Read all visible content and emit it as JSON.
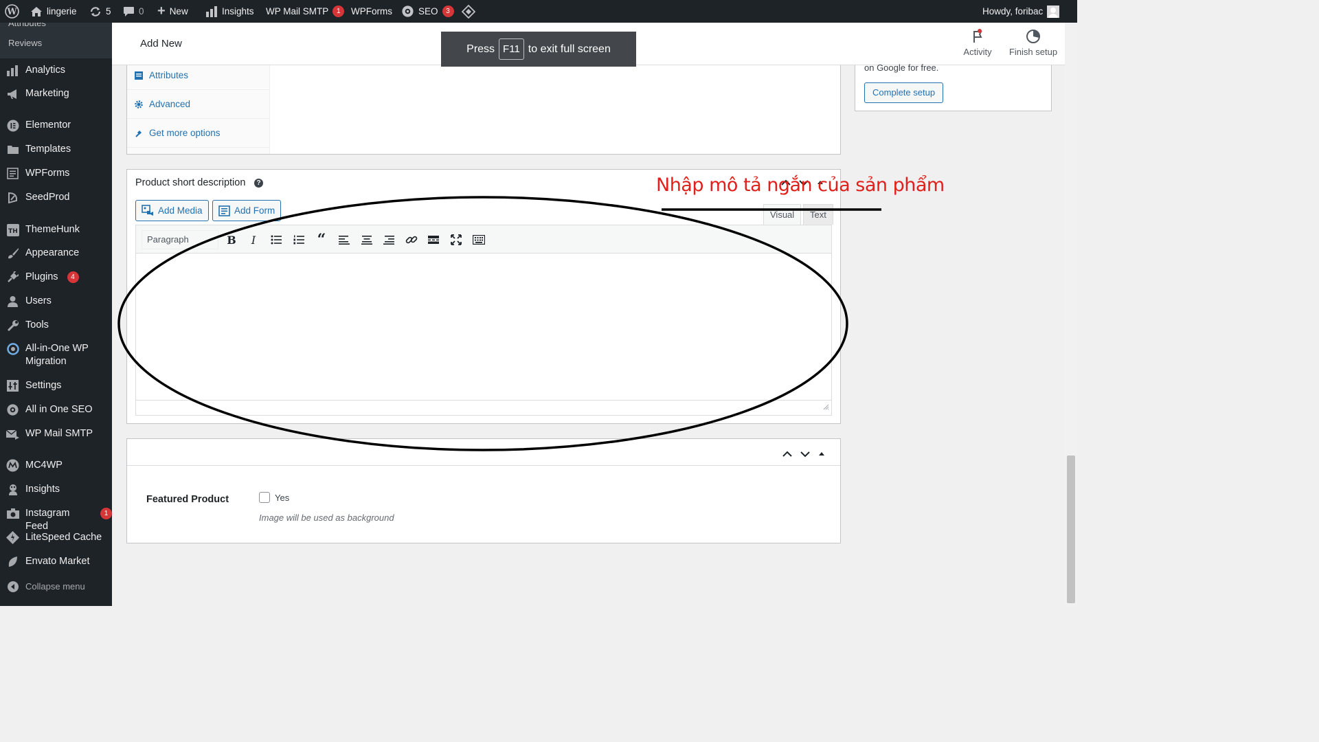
{
  "admin_bar": {
    "site_name": "lingerie",
    "updates_count": "5",
    "comments_count": "0",
    "new_label": "New",
    "insights_label": "Insights",
    "wpmail_label": "WP Mail SMTP",
    "wpmail_badge": "1",
    "wpforms_label": "WPForms",
    "seo_label": "SEO",
    "seo_badge": "3",
    "howdy": "Howdy, foribac"
  },
  "sidebar": {
    "sub_items": [
      "Attributes",
      "Reviews"
    ],
    "items": [
      {
        "label": "Analytics",
        "icon": "bar-chart-icon"
      },
      {
        "label": "Marketing",
        "icon": "megaphone-icon"
      },
      {
        "label": "Elementor",
        "icon": "elementor-icon"
      },
      {
        "label": "Templates",
        "icon": "folder-icon"
      },
      {
        "label": "WPForms",
        "icon": "form-icon"
      },
      {
        "label": "SeedProd",
        "icon": "seed-icon"
      },
      {
        "label": "ThemeHunk",
        "icon": "themehunk-icon"
      },
      {
        "label": "Appearance",
        "icon": "brush-icon"
      },
      {
        "label": "Plugins",
        "icon": "plug-icon",
        "badge": "4"
      },
      {
        "label": "Users",
        "icon": "user-icon"
      },
      {
        "label": "Tools",
        "icon": "wrench-icon"
      },
      {
        "label": "All-in-One WP Migration",
        "icon": "migration-icon"
      },
      {
        "label": "Settings",
        "icon": "settings-icon"
      },
      {
        "label": "All in One SEO",
        "icon": "seo-icon"
      },
      {
        "label": "WP Mail SMTP",
        "icon": "mail-icon"
      },
      {
        "label": "MC4WP",
        "icon": "mc4wp-icon"
      },
      {
        "label": "Insights",
        "icon": "insights-icon"
      },
      {
        "label": "Instagram Feed",
        "icon": "camera-icon",
        "badge": "1"
      },
      {
        "label": "LiteSpeed Cache",
        "icon": "litespeed-icon"
      },
      {
        "label": "Envato Market",
        "icon": "leaf-icon"
      },
      {
        "label": "Collapse menu",
        "icon": "collapse-icon"
      }
    ]
  },
  "header": {
    "title": "Add New",
    "activity_label": "Activity",
    "finish_label": "Finish setup"
  },
  "toast": {
    "press": "Press",
    "key": "F11",
    "rest": "to exit full screen"
  },
  "product_data": {
    "tabs": [
      "Attributes",
      "Advanced",
      "Get more options"
    ]
  },
  "google_box": {
    "text": "on Google for free.",
    "button": "Complete setup"
  },
  "short_description": {
    "title": "Product short description",
    "help": "?",
    "add_media": "Add Media",
    "add_form": "Add Form",
    "tab_visual": "Visual",
    "tab_text": "Text",
    "format": "Paragraph"
  },
  "featured": {
    "label": "Featured Product",
    "checkbox_label": "Yes",
    "hint": "Image will be used as background"
  },
  "annotation": {
    "text": "Nhập mô tả ngắn của sản phẩm",
    "color": "#e0201a"
  }
}
